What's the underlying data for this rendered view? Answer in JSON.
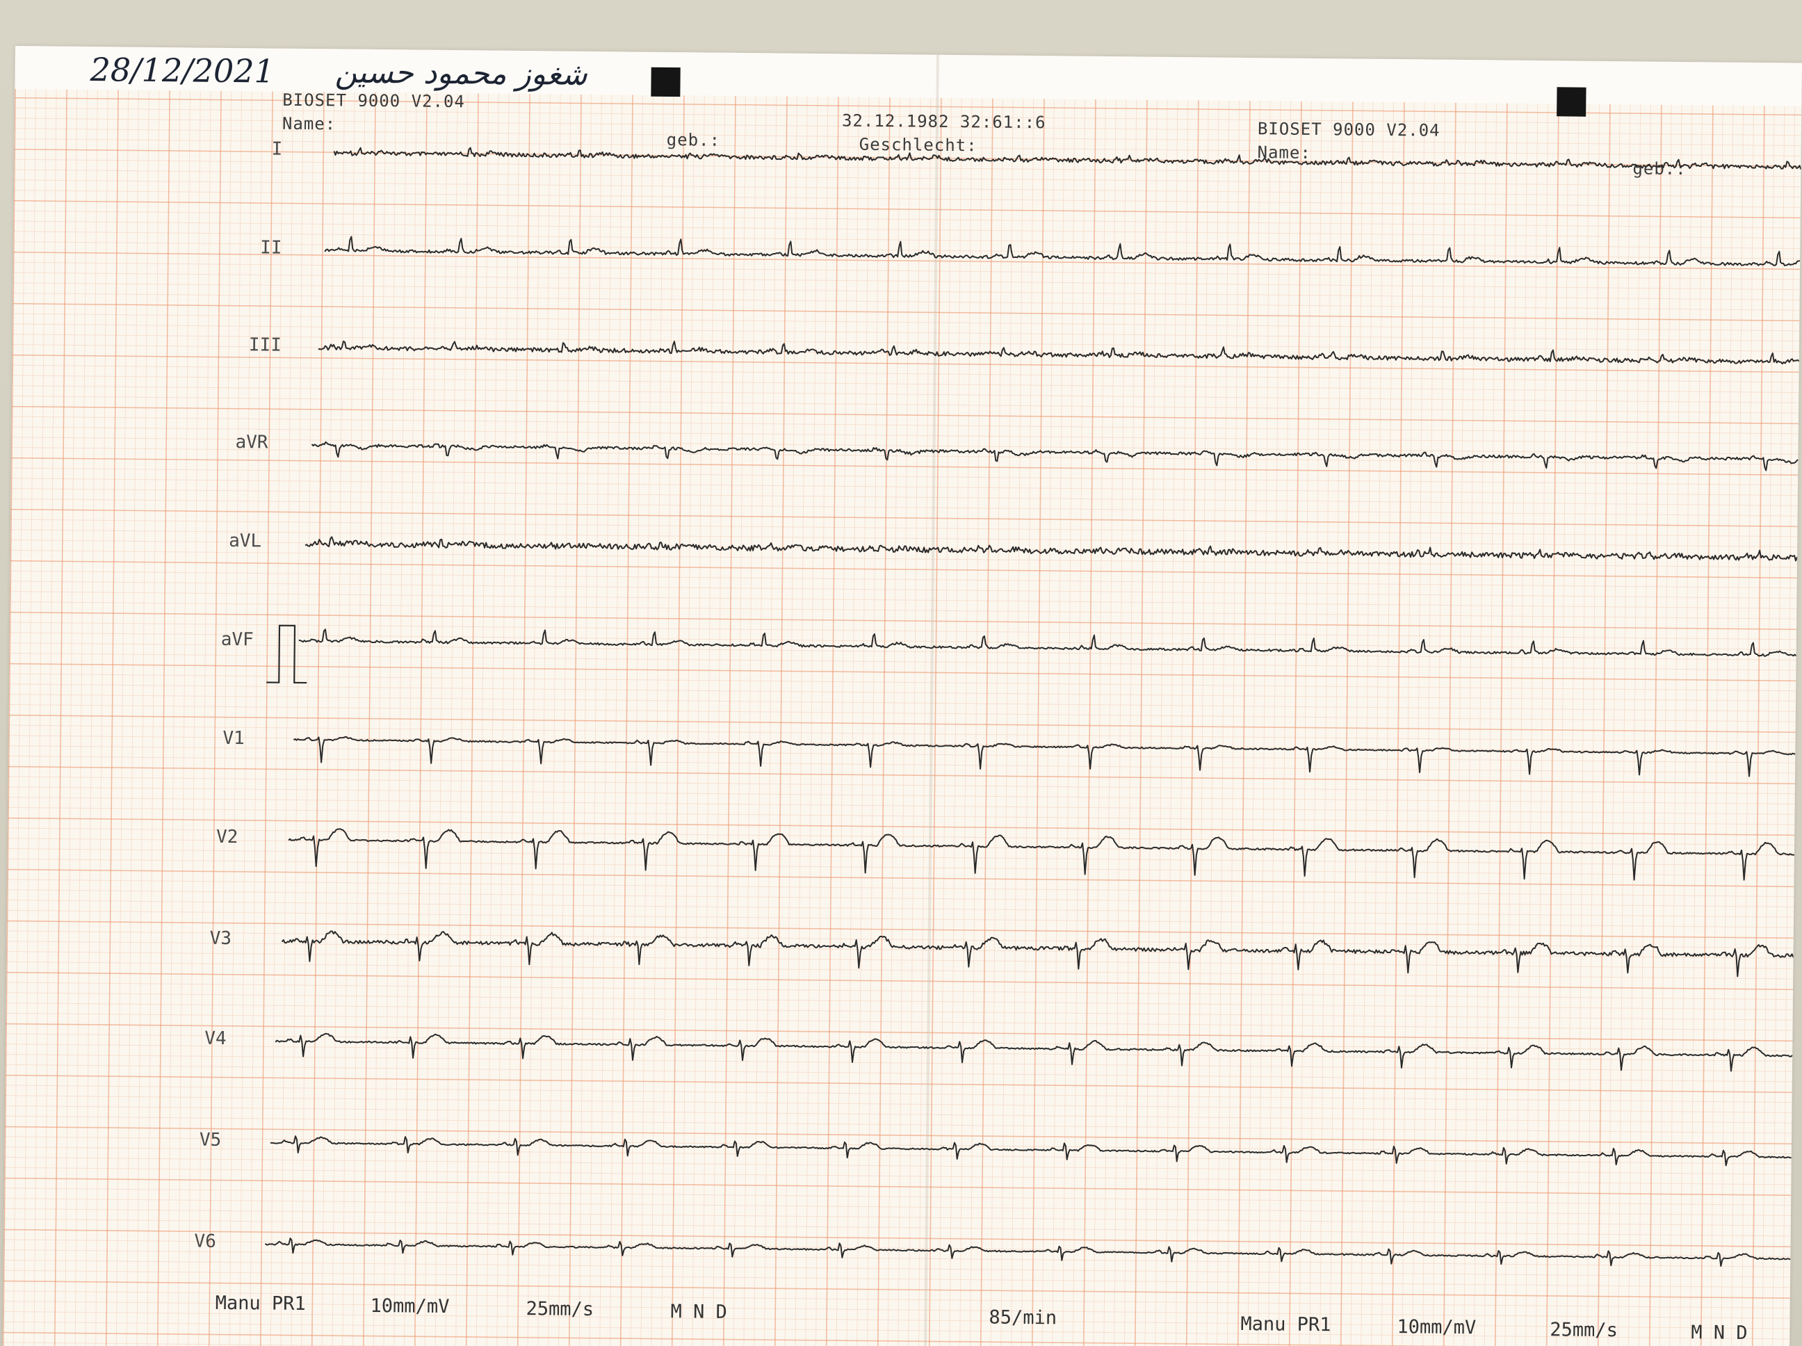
{
  "handwritten": {
    "date": "28/12/2021",
    "patient_name": "شغوز محمود حسين"
  },
  "printout": {
    "device_left": "BIOSET 9000 V2.04",
    "name_label_left": "Name:",
    "geb_label_left": "geb.:",
    "timestamp": "32.12.1982 32:61::6",
    "sex_label": "Geschlecht:",
    "device_right": "BIOSET 9000 V2.04",
    "name_label_right": "Name:",
    "geb_label_right": "geb.:"
  },
  "leads": [
    "I",
    "II",
    "III",
    "aVR",
    "aVL",
    "aVF",
    "V1",
    "V2",
    "V3",
    "V4",
    "V5",
    "V6"
  ],
  "footer": {
    "mode_left": "Manu PR1",
    "gain_left": "10mm/mV",
    "speed_left": "25mm/s",
    "filters_left": "M  N  D",
    "heart_rate": "85/min",
    "mode_right": "Manu PR1",
    "gain_right": "10mm/mV",
    "speed_right": "25mm/s",
    "filters_right": "M  N  D"
  },
  "colors": {
    "grid_major": "#ec966e",
    "grid_minor": "#f5c3aa",
    "paper": "#fbf7ef",
    "trace": "#2a2a2a"
  }
}
